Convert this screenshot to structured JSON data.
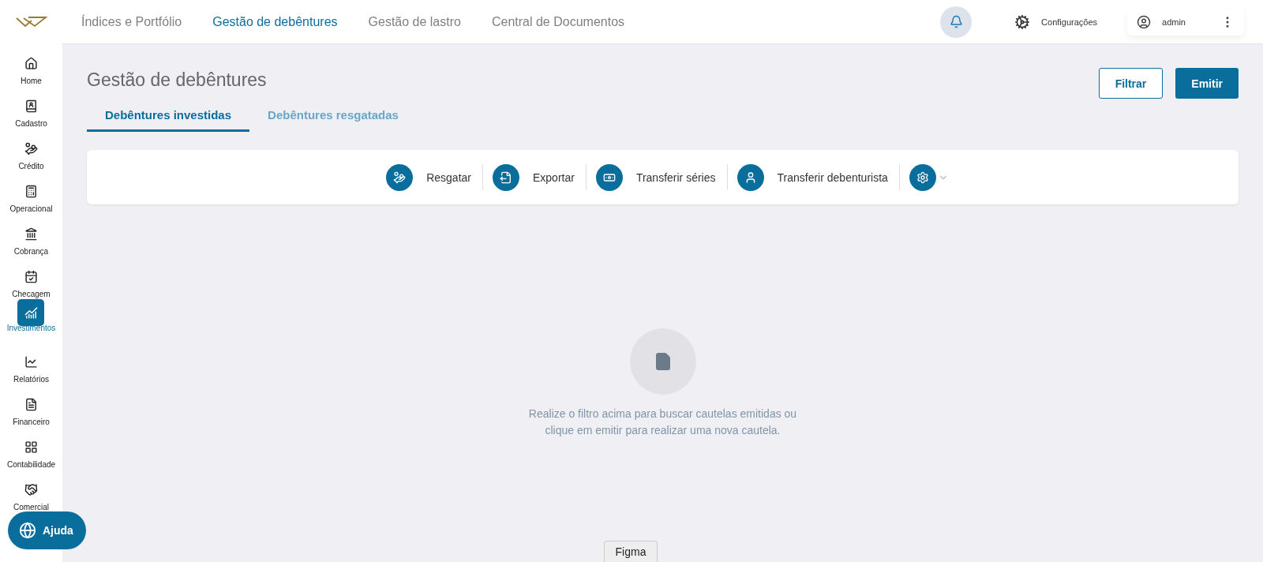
{
  "top_nav": [
    {
      "label": "Índices e Portfólio",
      "selected": false
    },
    {
      "label": "Gestão de debêntures",
      "selected": true
    },
    {
      "label": "Gestão de lastro",
      "selected": false
    },
    {
      "label": "Central de Documentos",
      "selected": false
    }
  ],
  "header": {
    "settings_label": "Configurações",
    "user": "admin"
  },
  "sidebar": {
    "items": [
      {
        "label": "Home",
        "selected": false
      },
      {
        "label": "Cadastro",
        "selected": false
      },
      {
        "label": "Crédito",
        "selected": false
      },
      {
        "label": "Operacional",
        "selected": false
      },
      {
        "label": "Cobrança",
        "selected": false
      },
      {
        "label": "Checagem",
        "selected": false
      },
      {
        "label": "Investimentos",
        "selected": true
      },
      {
        "label": "Relatórios",
        "selected": false
      },
      {
        "label": "Financeiro",
        "selected": false
      },
      {
        "label": "Contabilidade",
        "selected": false
      },
      {
        "label": "Comercial",
        "selected": false
      }
    ]
  },
  "page": {
    "title": "Gestão de debêntures",
    "buttons": [
      {
        "label": "Filtrar",
        "kind": "outline"
      },
      {
        "label": "Emitir",
        "kind": "primary"
      }
    ]
  },
  "tabs": [
    {
      "label": "Debêntures investidas",
      "selected": true
    },
    {
      "label": "Debêntures resgatadas",
      "selected": false
    }
  ],
  "actions": [
    {
      "label": "Resgatar"
    },
    {
      "label": "Exportar"
    },
    {
      "label": "Transferir séries"
    },
    {
      "label": "Transferir debenturista"
    }
  ],
  "empty_state": {
    "message": "Realize o filtro acima para buscar cautelas emitidas ou clique em emitir para realizar uma nova cautela."
  },
  "help_button": "Ajuda",
  "figma_button": "Figma"
}
